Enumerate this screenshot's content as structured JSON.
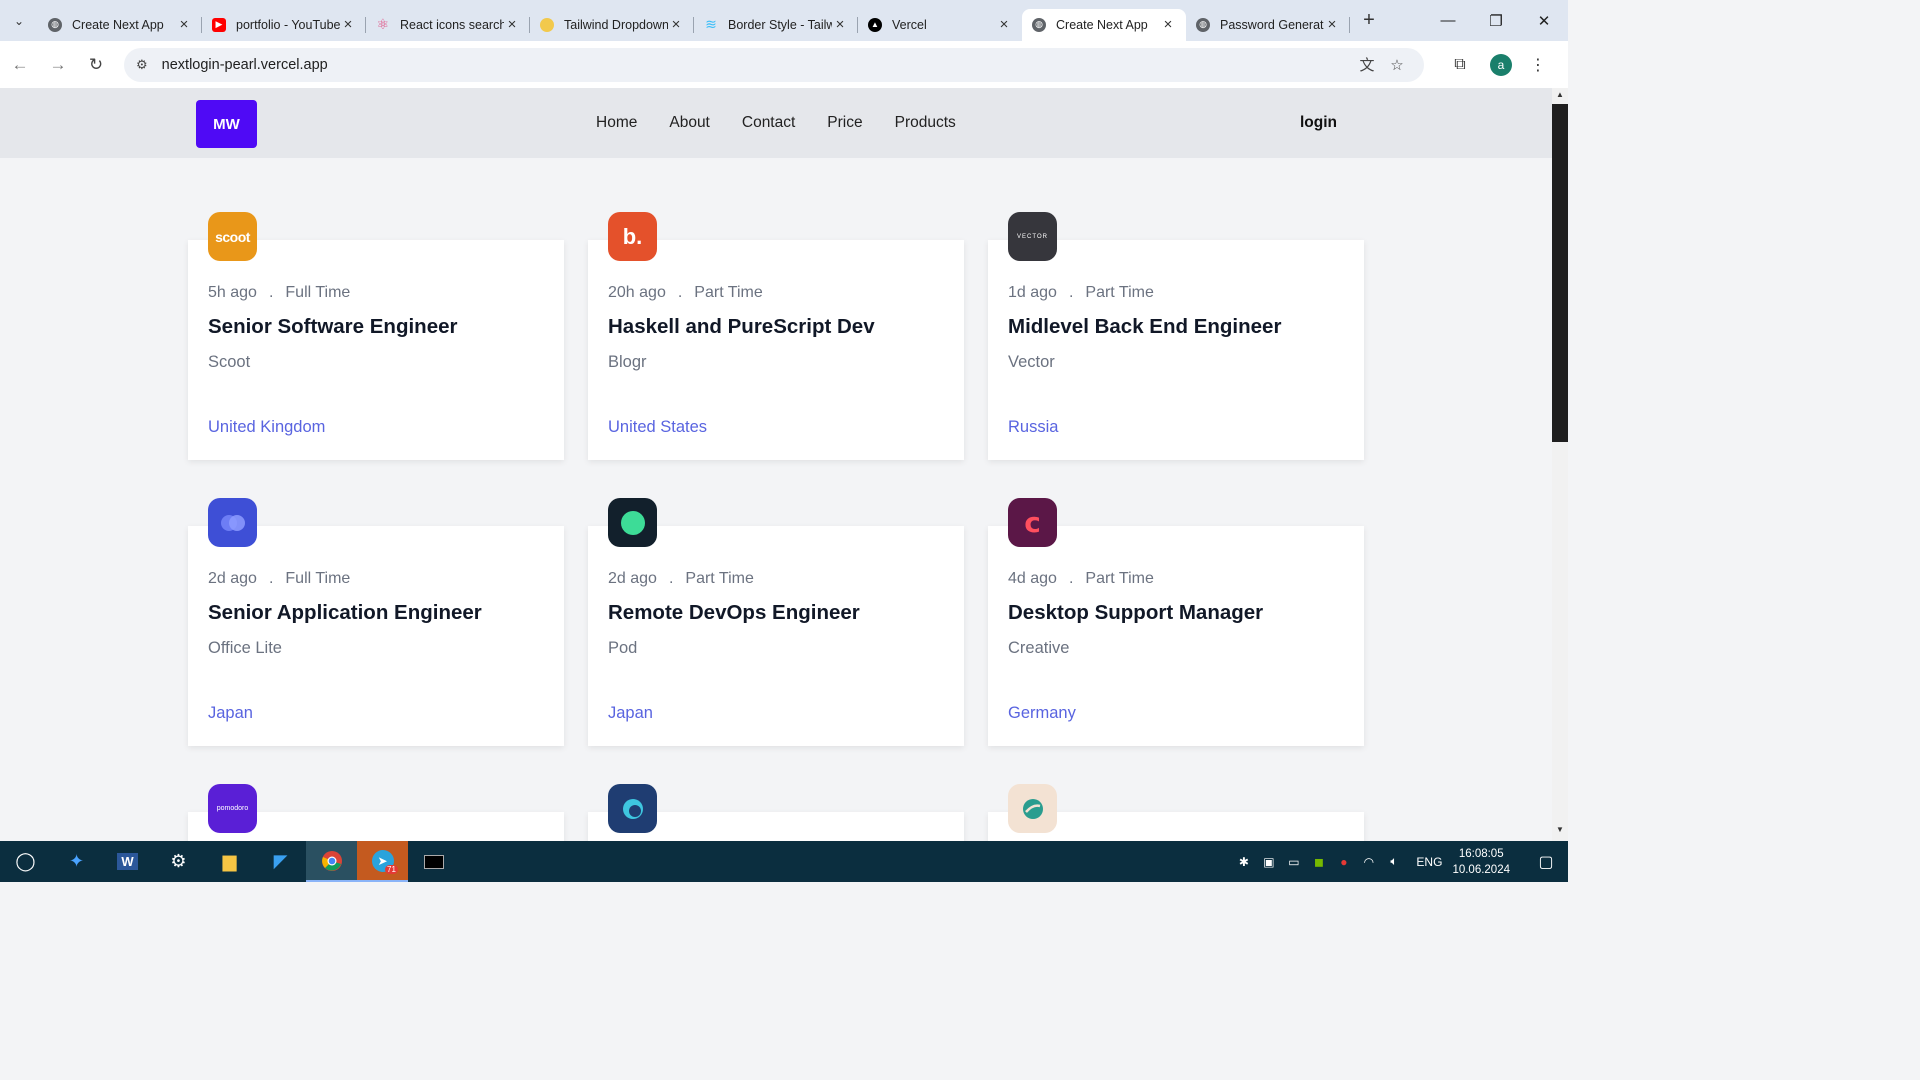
{
  "browser": {
    "tabs": [
      {
        "title": "Create Next App",
        "favicon": "globe-icon",
        "active": false
      },
      {
        "title": "portfolio - YouTube",
        "favicon": "youtube-icon",
        "active": false
      },
      {
        "title": "React icons search",
        "favicon": "react-icon",
        "active": false
      },
      {
        "title": "Tailwind Dropdown",
        "favicon": "tailwind-user-icon",
        "active": false
      },
      {
        "title": "Border Style - Tailwind",
        "favicon": "tailwind-icon",
        "active": false
      },
      {
        "title": "Vercel",
        "favicon": "vercel-icon",
        "active": false
      },
      {
        "title": "Create Next App",
        "favicon": "globe-icon",
        "active": true
      },
      {
        "title": "Password Generator",
        "favicon": "globe-icon",
        "active": false
      }
    ],
    "url": "nextlogin-pearl.vercel.app",
    "profile_initial": "a"
  },
  "site": {
    "logo": "MW",
    "nav": [
      "Home",
      "About",
      "Contact",
      "Price",
      "Products"
    ],
    "login": "login"
  },
  "jobs": [
    {
      "posted": "5h ago",
      "contract": "Full Time",
      "position": "Senior Software Engineer",
      "company": "Scoot",
      "location": "United Kingdom",
      "logo_text": "scoot",
      "logo_bg": "#e99719"
    },
    {
      "posted": "20h ago",
      "contract": "Part Time",
      "position": "Haskell and PureScript Dev",
      "company": "Blogr",
      "location": "United States",
      "logo_text": "b.",
      "logo_bg": "#e4512b"
    },
    {
      "posted": "1d ago",
      "contract": "Part Time",
      "position": "Midlevel Back End Engineer",
      "company": "Vector",
      "location": "Russia",
      "logo_text": "VECTOR",
      "logo_bg": "#36363c"
    },
    {
      "posted": "2d ago",
      "contract": "Full Time",
      "position": "Senior Application Engineer",
      "company": "Office Lite",
      "location": "Japan",
      "logo_text": "",
      "logo_bg": "#3e4fd6"
    },
    {
      "posted": "2d ago",
      "contract": "Part Time",
      "position": "Remote DevOps Engineer",
      "company": "Pod",
      "location": "Japan",
      "logo_text": "",
      "logo_bg": "#12202c"
    },
    {
      "posted": "4d ago",
      "contract": "Part Time",
      "position": "Desktop Support Manager",
      "company": "Creative",
      "location": "Germany",
      "logo_text": "c",
      "logo_bg": "#5b1747"
    },
    {
      "logo_text": "pomodoro",
      "logo_bg": "#5a1fd6"
    },
    {
      "logo_text": "",
      "logo_bg": "#1f3d72"
    },
    {
      "logo_text": "",
      "logo_bg": "#f3e2d3"
    }
  ],
  "taskbar": {
    "apps": [
      "start-icon",
      "pin-icon",
      "word-icon",
      "settings-icon",
      "file-explorer-icon",
      "vscode-icon",
      "chrome-icon",
      "telegram-icon",
      "terminal-icon"
    ],
    "telegram_badge": "71",
    "language": "ENG",
    "time": "16:08:05",
    "date": "10.06.2024"
  }
}
